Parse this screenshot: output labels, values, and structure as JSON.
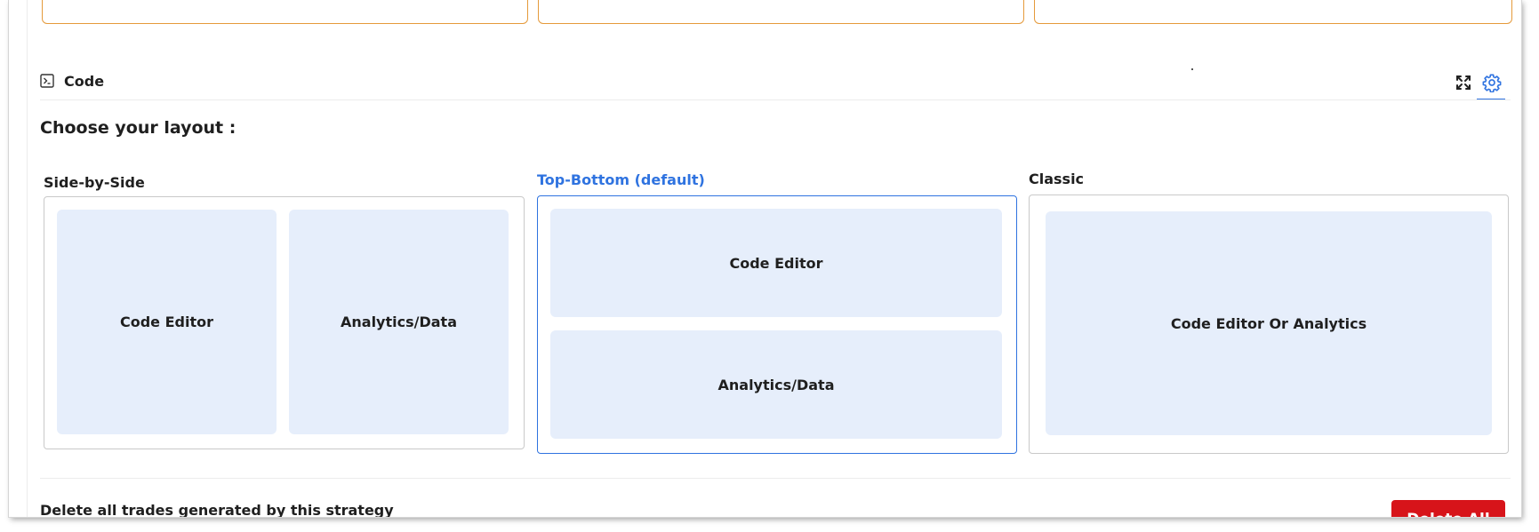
{
  "code_section": {
    "title": "Code",
    "icons": [
      "terminal-icon",
      "fullscreen-icon",
      "settings-icon"
    ]
  },
  "layout": {
    "heading": "Choose your layout :",
    "options": [
      {
        "label": "Side-by-Side",
        "selected": false,
        "panes": [
          "Code Editor",
          "Analytics/Data"
        ]
      },
      {
        "label": "Top-Bottom (default)",
        "selected": true,
        "panes": [
          "Code Editor",
          "Analytics/Data"
        ]
      },
      {
        "label": "Classic",
        "selected": false,
        "panes": [
          "Code Editor Or Analytics"
        ]
      }
    ]
  },
  "danger": {
    "description": "Delete all trades generated by this strategy",
    "button_label": "Delete All"
  },
  "colors": {
    "accent": "#2f73e0",
    "pane_bg": "#e6eefb",
    "danger": "#d7141a",
    "card_border": "#e59a3b"
  }
}
